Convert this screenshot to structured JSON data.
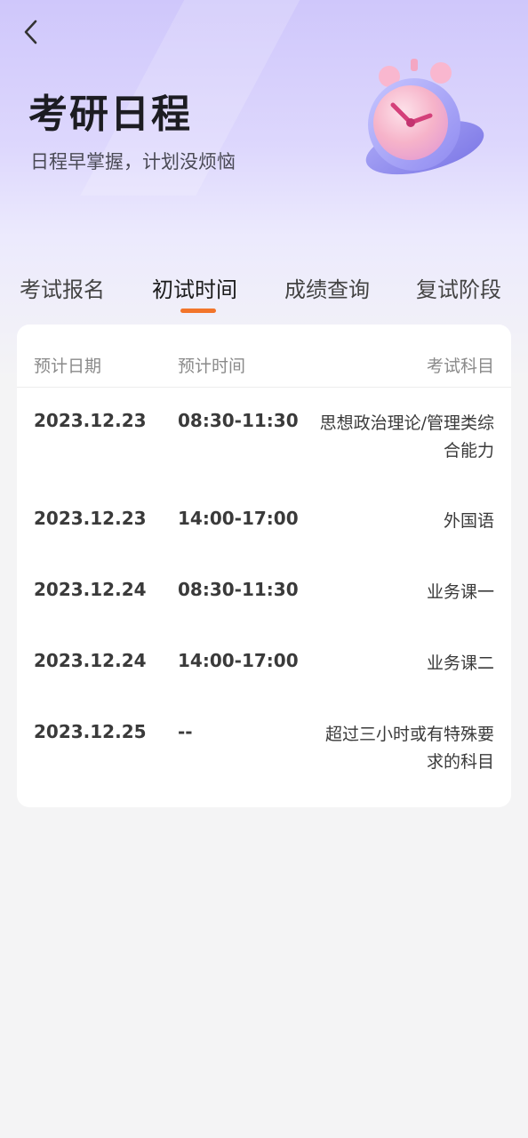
{
  "header": {
    "title": "考研日程",
    "subtitle": "日程早掌握，计划没烦恼"
  },
  "tabs": [
    {
      "label": "考试报名",
      "active": false
    },
    {
      "label": "初试时间",
      "active": true
    },
    {
      "label": "成绩查询",
      "active": false
    },
    {
      "label": "复试阶段",
      "active": false
    }
  ],
  "table": {
    "headers": {
      "date": "预计日期",
      "time": "预计时间",
      "subject": "考试科目"
    },
    "rows": [
      {
        "date": "2023.12.23",
        "time": "08:30-11:30",
        "subject": "思想政治理论/管理类综合能力"
      },
      {
        "date": "2023.12.23",
        "time": "14:00-17:00",
        "subject": "外国语"
      },
      {
        "date": "2023.12.24",
        "time": "08:30-11:30",
        "subject": "业务课一"
      },
      {
        "date": "2023.12.24",
        "time": "14:00-17:00",
        "subject": "业务课二"
      },
      {
        "date": "2023.12.25",
        "time": "--",
        "subject": "超过三小时或有特殊要求的科目"
      }
    ]
  },
  "colors": {
    "accent": "#f2752b",
    "hero_purple": "#cfc7fb",
    "clock_face": "#f7b6c9"
  },
  "icons": {
    "back": "chevron-left-icon",
    "illustration": "alarm-clock-icon"
  }
}
